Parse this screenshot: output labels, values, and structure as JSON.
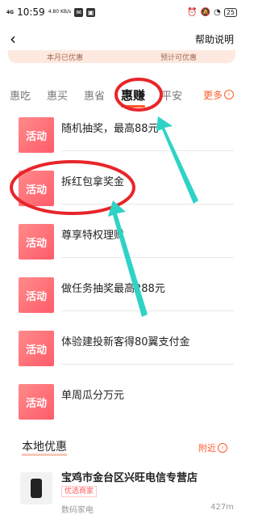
{
  "status_bar": {
    "signal": "4G",
    "time": "10:59",
    "net_speed": "4.80 KB/s",
    "notif_icons": [
      "message-icon",
      "app-icon"
    ],
    "right_icons": [
      "alarm-icon",
      "silent-icon",
      "wifi-icon"
    ],
    "battery": "25"
  },
  "nav": {
    "back_icon": "back-arrow-icon",
    "help_label": "帮助说明"
  },
  "savings": {
    "this_month_label": "本月已优惠",
    "estimate_label": "预计可优惠"
  },
  "tabs": {
    "items": [
      "惠吃",
      "惠买",
      "惠省",
      "惠赚",
      "平安"
    ],
    "active": "惠赚",
    "more_label": "更多"
  },
  "activities": {
    "badge_label": "活动",
    "items": [
      "随机抽奖，最高88元",
      "拆红包拿奖金",
      "尊享特权理财",
      "做任务抽奖最高288元",
      "体验建投新客得80翼支付金",
      "单周瓜分万元"
    ]
  },
  "local": {
    "title": "本地优惠",
    "nearby_label": "附近"
  },
  "store": {
    "name": "宝鸡市金台区兴旺电信专营店",
    "badge": "优选商家",
    "category": "数码家电",
    "distance": "427m"
  },
  "annotation": {
    "color": "#e8252a",
    "arrow_color": "#2ed3c6"
  }
}
